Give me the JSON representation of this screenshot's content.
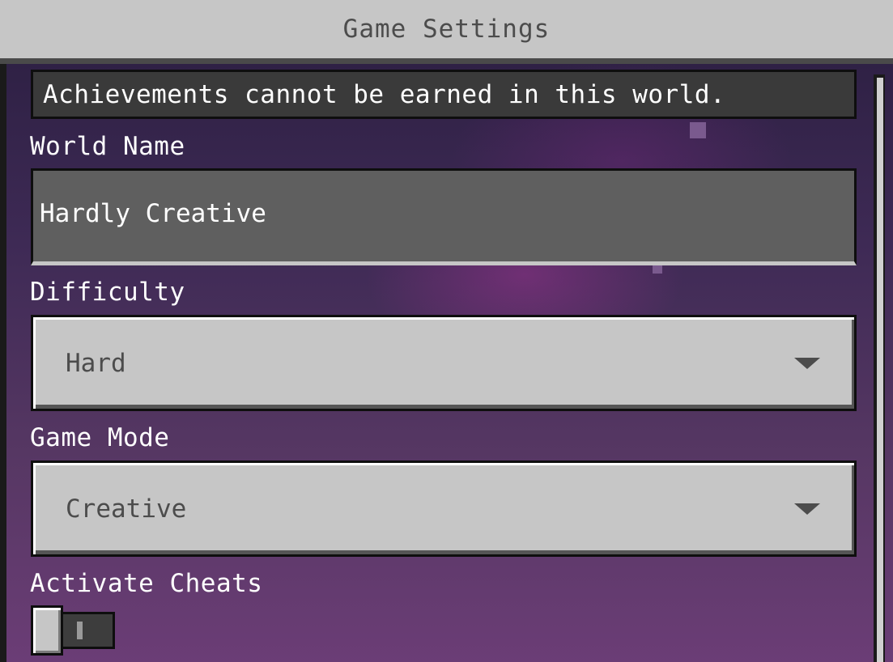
{
  "window": {
    "title": "Game Settings"
  },
  "notice": {
    "text": "Achievements cannot be earned in this world."
  },
  "world_name": {
    "label": "World Name",
    "value": "Hardly Creative"
  },
  "difficulty": {
    "label": "Difficulty",
    "selected": "Hard"
  },
  "game_mode": {
    "label": "Game Mode",
    "selected": "Creative"
  },
  "cheats": {
    "label": "Activate Cheats",
    "enabled": false
  },
  "icons": {
    "dropdown_chevron": "chevron-down-icon"
  },
  "colors": {
    "title_bar": "#c6c6c6",
    "panel_top": "#2f2145",
    "panel_bottom": "#6b3d76",
    "notice_bg": "#3a3a3a",
    "field_bg": "#5f5f5f",
    "dropdown_bg": "#c6c6c6"
  }
}
